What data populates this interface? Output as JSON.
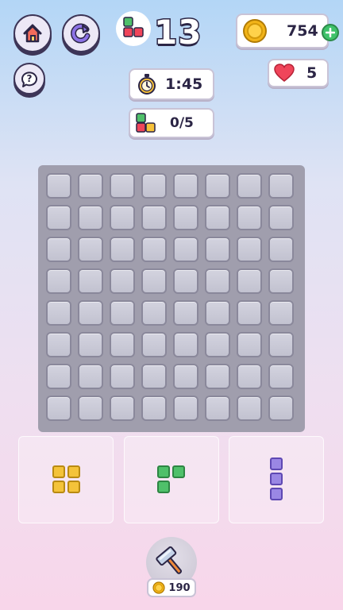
{
  "header": {
    "level_number": "13",
    "coins": "754",
    "lives": "5",
    "timer": "1:45",
    "goal_progress": "0/5"
  },
  "icons": {
    "home": "home-icon",
    "restart": "restart-icon",
    "help": "question-icon",
    "coin": "coin-icon",
    "heart": "heart-icon",
    "stopwatch": "stopwatch-icon",
    "hammer": "hammer-icon",
    "add": "plus-icon"
  },
  "board": {
    "rows": 8,
    "cols": 8,
    "filled_cells": 0
  },
  "pieces": [
    {
      "name": "square-2x2",
      "color": "#f4c33a"
    },
    {
      "name": "l-shape",
      "color": "#4fc06a"
    },
    {
      "name": "vertical-line-3",
      "color": "#9a87e4"
    }
  ],
  "booster": {
    "name": "hammer",
    "cost": "190"
  },
  "colors": {
    "accent_dark": "#2b2545",
    "plus_green": "#3ec26a",
    "heart_red": "#f0455a",
    "coin_gold": "#f2b418"
  }
}
